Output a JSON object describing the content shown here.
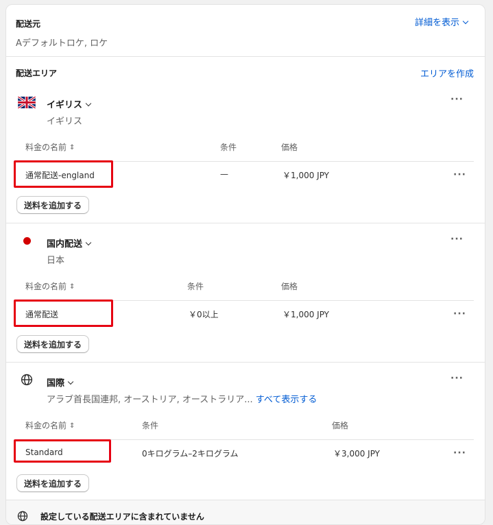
{
  "origin": {
    "title": "配送元",
    "address": "Aデフォルトロケ, ロケ",
    "details_link": "詳細を表示"
  },
  "zones_section": {
    "title": "配送エリア",
    "create_link": "エリアを作成"
  },
  "zones": [
    {
      "name": "イギリス",
      "icon": "uk-flag-icon",
      "subtitle": "イギリス",
      "headers": [
        "料金の名前",
        "条件",
        "価格"
      ],
      "rate": {
        "name": "通常配送-england",
        "condition": "—",
        "price": "￥1,000 JPY"
      },
      "add_button": "送料を追加する"
    },
    {
      "name": "国内配送",
      "icon": "japan-flag-icon",
      "subtitle": "日本",
      "headers": [
        "料金の名前",
        "条件",
        "価格"
      ],
      "rate": {
        "name": "通常配送",
        "condition": "￥0以上",
        "price": "￥1,000 JPY"
      },
      "add_button": "送料を追加する"
    },
    {
      "name": "国際",
      "icon": "globe-icon",
      "subtitle": "アラブ首長国連邦, オーストリア, オーストラリア...",
      "show_all_link": "すべて表示する",
      "headers": [
        "料金の名前",
        "条件",
        "価格"
      ],
      "rate": {
        "name": "Standard",
        "condition": "0キログラム–2キログラム",
        "price": "￥3,000 JPY"
      },
      "add_button": "送料を追加する"
    }
  ],
  "footer": {
    "text": "設定している配送エリアに含まれていません"
  },
  "colors": {
    "accent": "#005bd3",
    "highlight": "#e60012",
    "japan_red": "#d30000"
  }
}
